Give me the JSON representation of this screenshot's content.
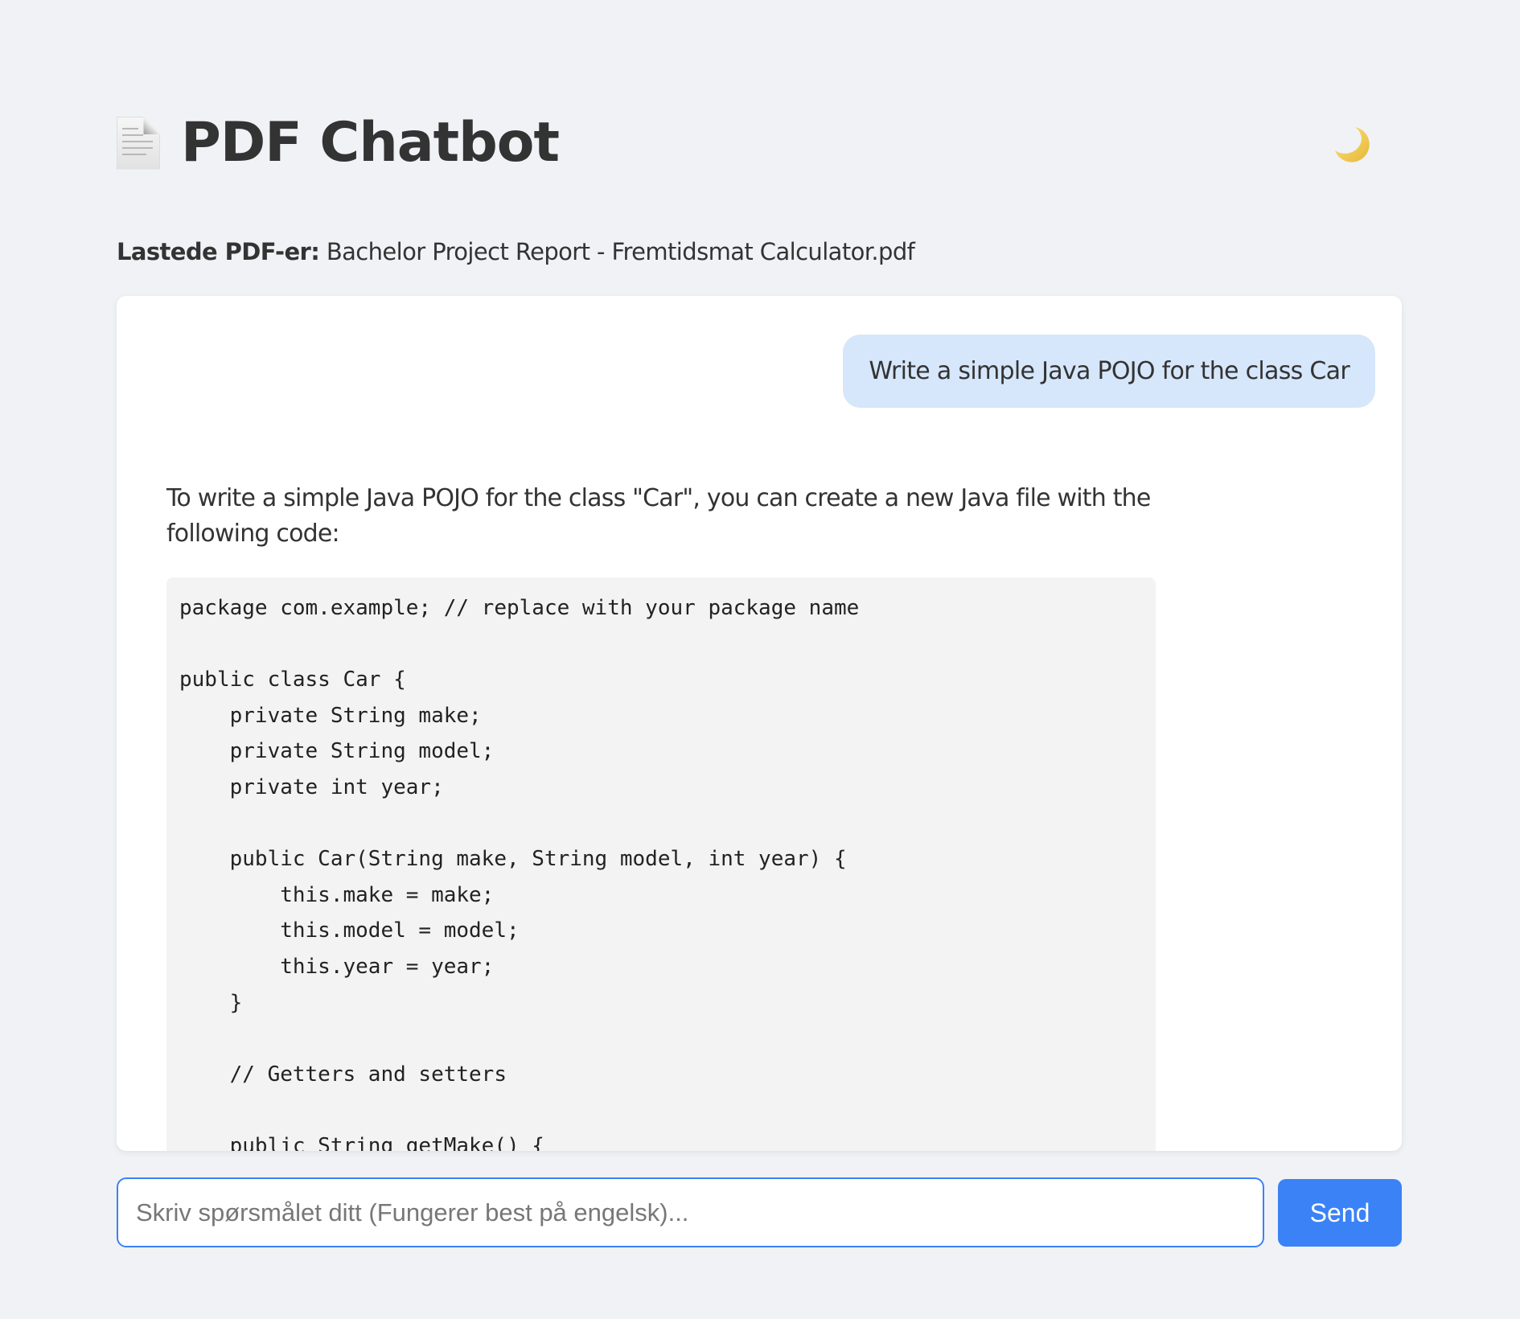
{
  "header": {
    "icon": "page-facing-up-icon",
    "title": "PDF Chatbot",
    "theme_toggle_icon": "crescent-moon-icon",
    "theme_toggle_glyph": "🌙"
  },
  "loaded_pdfs": {
    "label": "Lastede PDF-er:",
    "files": "Bachelor Project Report - Fremtidsmat Calculator.pdf"
  },
  "chat": {
    "messages": [
      {
        "role": "user",
        "text": "Write a simple Java POJO for the class Car"
      },
      {
        "role": "bot",
        "text": "To write a simple Java POJO for the class \"Car\", you can create a new Java file with the following code:",
        "code": "package com.example; // replace with your package name\n\npublic class Car {\n    private String make;\n    private String model;\n    private int year;\n\n    public Car(String make, String model, int year) {\n        this.make = make;\n        this.model = model;\n        this.year = year;\n    }\n\n    // Getters and setters\n\n    public String getMake() {"
      }
    ]
  },
  "composer": {
    "placeholder": "Skriv spørsmålet ditt (Fungerer best på engelsk)...",
    "value": "",
    "send_label": "Send"
  },
  "colors": {
    "accent": "#3b82f6",
    "user_bubble": "#d6e6fb",
    "background": "#f0f2f6"
  }
}
